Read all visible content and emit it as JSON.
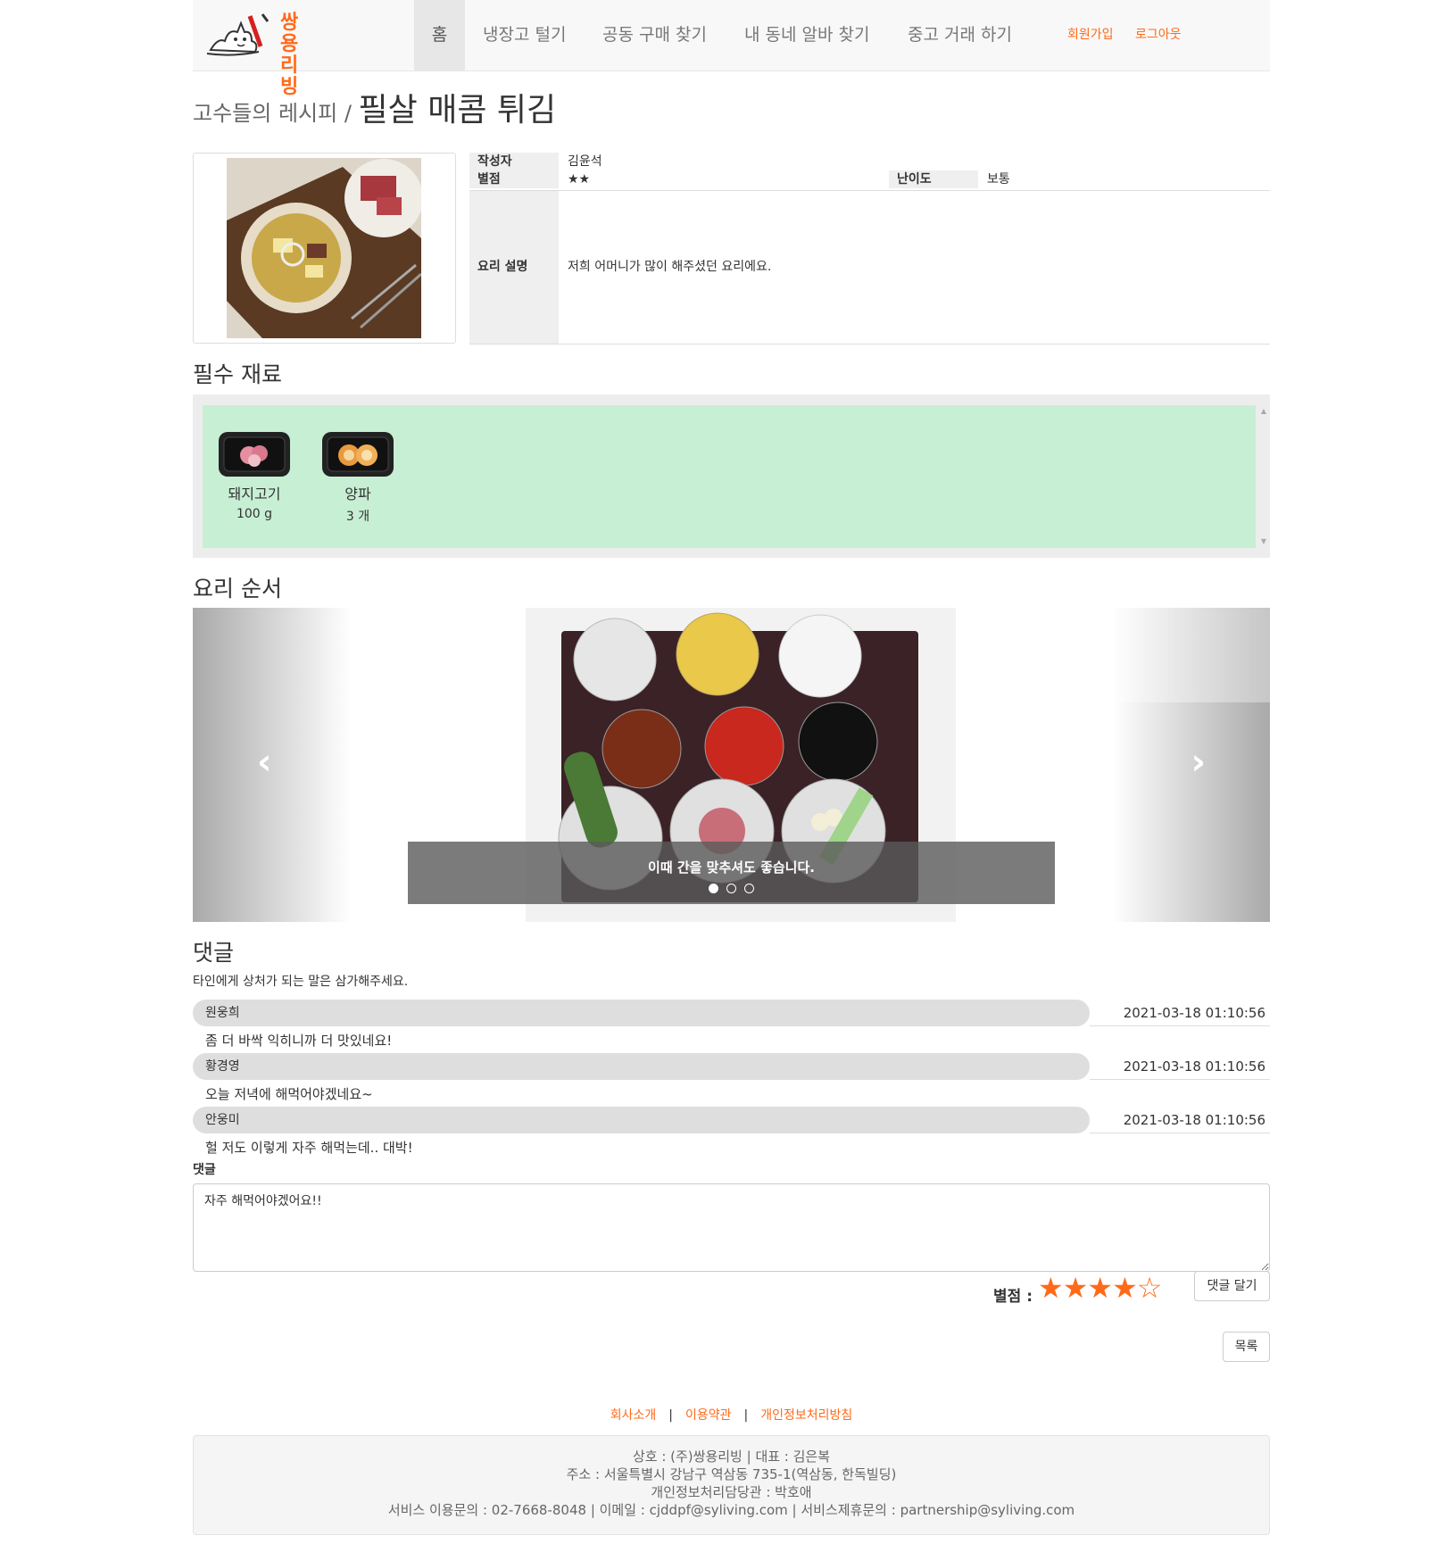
{
  "nav": {
    "logo_text_line1": "쌍용",
    "logo_text_line2": "리빙",
    "items": [
      "홈",
      "냉장고 털기",
      "공동 구매 찾기",
      "내 동네 알바 찾기",
      "중고 거래 하기"
    ],
    "signup": "회원가입",
    "logout": "로그아웃"
  },
  "title": {
    "prefix": "고수들의 레시피 /",
    "name": "필살 매콤 튀김"
  },
  "info": {
    "author_label": "작성자",
    "author": "김윤석",
    "rating_label": "별점",
    "rating": "★★",
    "difficulty_label": "난이도",
    "difficulty": "보통",
    "desc_label": "요리 설명",
    "desc": "저희 어머니가 많이 해주셨던 요리에요."
  },
  "ingredients": {
    "heading": "필수 재료",
    "items": [
      {
        "name": "돼지고기",
        "amount": "100 g"
      },
      {
        "name": "양파",
        "amount": "3 개"
      }
    ]
  },
  "steps": {
    "heading": "요리 순서",
    "caption": "이때 간을 맞추셔도 좋습니다.",
    "prev_icon": "‹",
    "next_icon": "›"
  },
  "comments": {
    "heading": "댓글",
    "note": "타인에게 상처가 되는 말은 삼가해주세요.",
    "list": [
      {
        "author": "원웅희",
        "date": "2021-03-18 01:10:56",
        "text": "좀 더 바싹 익히니까 더 맛있네요!"
      },
      {
        "author": "황경영",
        "date": "2021-03-18 01:10:56",
        "text": "오늘 저녁에 해먹어야겠네요~"
      },
      {
        "author": "안웅미",
        "date": "2021-03-18 01:10:56",
        "text": "헐 저도 이렇게 자주 해먹는데.. 대박!"
      }
    ],
    "input_label": "댓글",
    "input_value": "자주 해먹어야겠어요!!",
    "rating_label": "별점 :",
    "rating_stars": "★★★★☆",
    "submit": "댓글 달기",
    "list_button": "목록"
  },
  "footer": {
    "links": [
      "회사소개",
      "이용약관",
      "개인정보처리방침"
    ],
    "line1": "상호 : (주)쌍용리빙 | 대표 : 김은복",
    "line2": "주소 : 서울특별시 강남구 역삼동 735-1(역삼동, 한독빌딩)",
    "line3": "개인정보처리담당관 : 박호애",
    "line4": "서비스 이용문의 : 02-7668-8048 | 이메일 : cjddpf@syliving.com | 서비스제휴문의 : partnership@syliving.com"
  },
  "colors": {
    "accent": "#ff6a1a",
    "ingredient_bg": "#c7efd4"
  }
}
